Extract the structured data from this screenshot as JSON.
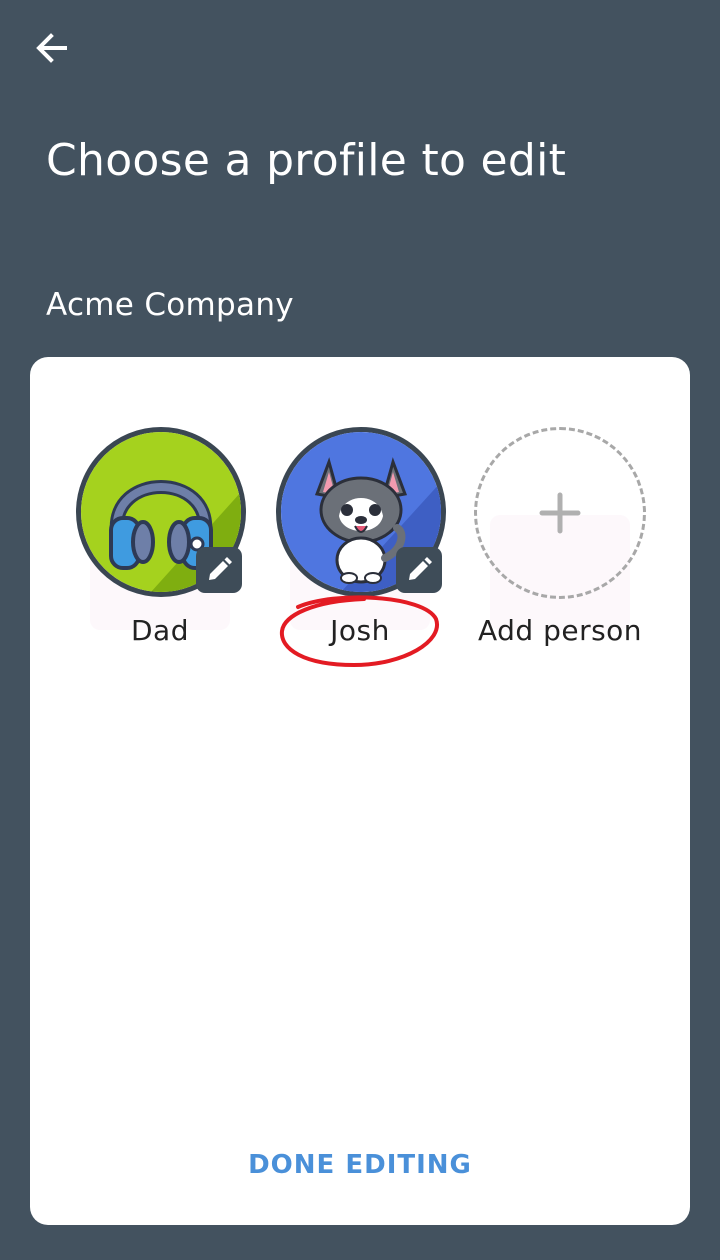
{
  "header": {
    "back_icon": "arrow-left-icon",
    "title": "Choose a profile to edit"
  },
  "group": {
    "name": "Acme Company"
  },
  "profiles": [
    {
      "name": "Dad",
      "avatar": "headphones-avatar",
      "edit_icon": "pencil-icon",
      "avatar_color": "#a5d21e"
    },
    {
      "name": "Josh",
      "avatar": "husky-dog-avatar",
      "edit_icon": "pencil-icon",
      "avatar_color": "#4f76e0"
    }
  ],
  "add_person": {
    "label": "Add person",
    "icon": "plus-icon"
  },
  "footer": {
    "done_label": "DONE EDITING"
  },
  "colors": {
    "background": "#43525f",
    "card": "#ffffff",
    "accent": "#4a90d9",
    "annotation": "#e31b23"
  }
}
